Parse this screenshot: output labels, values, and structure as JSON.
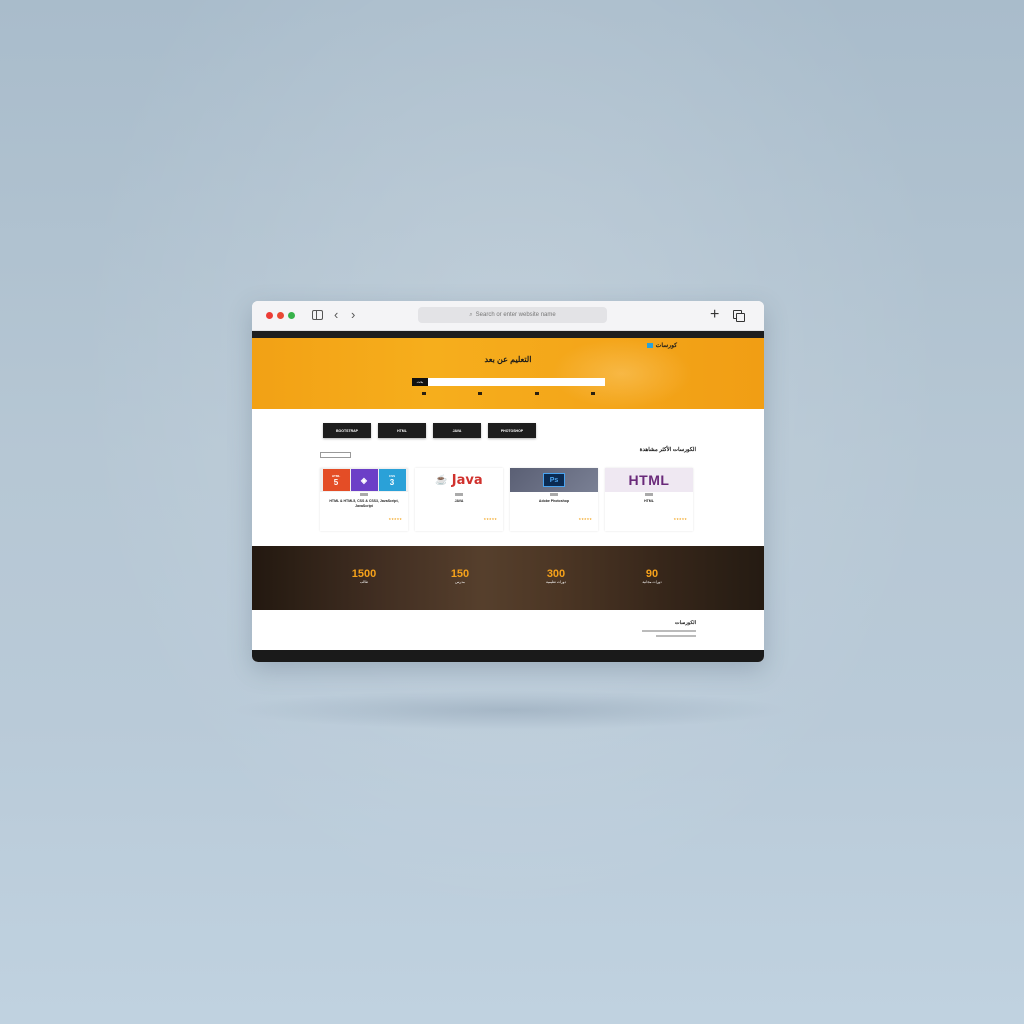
{
  "browser": {
    "address_placeholder": "Search or enter website name",
    "back_glyph": "‹",
    "forward_glyph": "›",
    "new_tab_glyph": "+"
  },
  "site": {
    "topbar_left": "",
    "topbar_right": "",
    "logo_text": "كورسات",
    "nav_items": [
      "",
      "",
      "",
      "",
      "",
      ""
    ],
    "hero_title": "التعليم عن بعد",
    "hero_subtitle": "",
    "search_button": "بحث",
    "search_placeholder": "",
    "features": [
      "",
      "",
      "",
      ""
    ]
  },
  "categories": [
    "BOOTSTRAP",
    "HTML",
    "JAVA",
    "PHOTOSHOP"
  ],
  "popular": {
    "title": "الكورسات الأكثر مشاهدة",
    "view_all": "",
    "cards": [
      {
        "thumb": "html-css-js",
        "title": "HTML & HTML5, CSS & CSS3, JavaScript, JavaScript",
        "price": "",
        "stars": "★★★★★"
      },
      {
        "thumb": "java",
        "title": "JAVA",
        "price": "",
        "stars": "★★★★★"
      },
      {
        "thumb": "photoshop",
        "title": "Adobe Photoshop",
        "price": "",
        "stars": "★★★★★"
      },
      {
        "thumb": "html",
        "title": "HTML",
        "price": "",
        "stars": "★★★★★"
      }
    ],
    "thumb_text": {
      "html_label": "HTML",
      "html_num": "5",
      "css_label": "CSS",
      "css_num": "3",
      "java_word": "Java",
      "ps_word": "Ps",
      "html_word": "HTML"
    }
  },
  "stats": [
    {
      "value": "1500",
      "label": "طالب"
    },
    {
      "value": "150",
      "label": "مدرس"
    },
    {
      "value": "300",
      "label": "دورات تعليمية"
    },
    {
      "value": "90",
      "label": "دورات مجانية"
    }
  ],
  "about": {
    "title": "الكورسات"
  },
  "colors": {
    "accent": "#f6a21a",
    "hero_bg": "#f4a61a",
    "dark": "#1d1d1d",
    "price_red": "#e53b2e"
  }
}
